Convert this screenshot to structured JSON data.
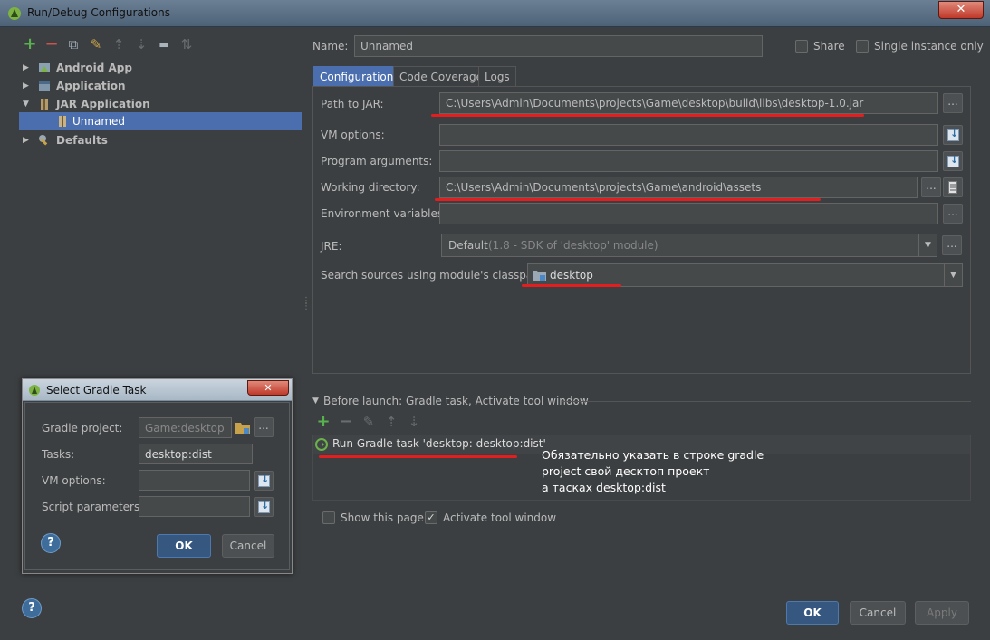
{
  "window": {
    "title": "Run/Debug Configurations",
    "close_glyph": "✕"
  },
  "toolbar": {
    "add": "+",
    "remove": "−",
    "copy": "⧉",
    "edit": "✎",
    "up": "⇡",
    "down": "⇣",
    "folder": "▬",
    "sort": "⇅"
  },
  "tree": {
    "items": [
      {
        "label": "Android App"
      },
      {
        "label": "Application"
      },
      {
        "label": "JAR Application"
      },
      {
        "label": "Unnamed"
      },
      {
        "label": "Defaults"
      }
    ]
  },
  "header": {
    "name_label": "Name:",
    "name_value": "Unnamed",
    "share_label": "Share",
    "single_instance_label": "Single instance only"
  },
  "tabs": [
    {
      "label": "Configuration"
    },
    {
      "label": "Code Coverage"
    },
    {
      "label": "Logs"
    }
  ],
  "config": {
    "path_to_jar_label": "Path to JAR:",
    "path_to_jar_value": "C:\\Users\\Admin\\Documents\\projects\\Game\\desktop\\build\\libs\\desktop-1.0.jar",
    "vm_options_label": "VM options:",
    "program_arguments_label": "Program arguments:",
    "working_directory_label": "Working directory:",
    "working_directory_value": "C:\\Users\\Admin\\Documents\\projects\\Game\\android\\assets",
    "environment_variables_label": "Environment variables:",
    "jre_label": "JRE:",
    "jre_value": "Default",
    "jre_detail": "(1.8 - SDK of 'desktop' module)",
    "classpath_label": "Search sources using module's classpath:",
    "classpath_value": "desktop",
    "browse_glyph": "..."
  },
  "before_launch": {
    "header": "Before launch: Gradle task, Activate tool window",
    "task": "Run Gradle task 'desktop: desktop:dist'",
    "show_this_page_label": "Show this page",
    "activate_tool_window_label": "Activate tool window",
    "activate_checked_glyph": "✓"
  },
  "annotation": {
    "line1": "Обязательно указать в строке gradle",
    "line2": "project свой десктоп проект",
    "line3": "а тасках desktop:dist"
  },
  "gradle_dialog": {
    "title": "Select Gradle Task",
    "project_label": "Gradle project:",
    "project_value": "Game:desktop",
    "tasks_label": "Tasks:",
    "tasks_value": "desktop:dist",
    "vm_options_label": "VM options:",
    "script_parameters_label": "Script parameters:",
    "ok_label": "OK",
    "cancel_label": "Cancel",
    "help_glyph": "?",
    "close_glyph": "✕"
  },
  "footer": {
    "ok_label": "OK",
    "cancel_label": "Cancel",
    "apply_label": "Apply",
    "help_glyph": "?"
  },
  "colors": {
    "background": "#3c3f41",
    "selection": "#4b6eaf",
    "annotation_line": "#e41e1e",
    "add": "#58b04e",
    "remove": "#d0524d"
  }
}
